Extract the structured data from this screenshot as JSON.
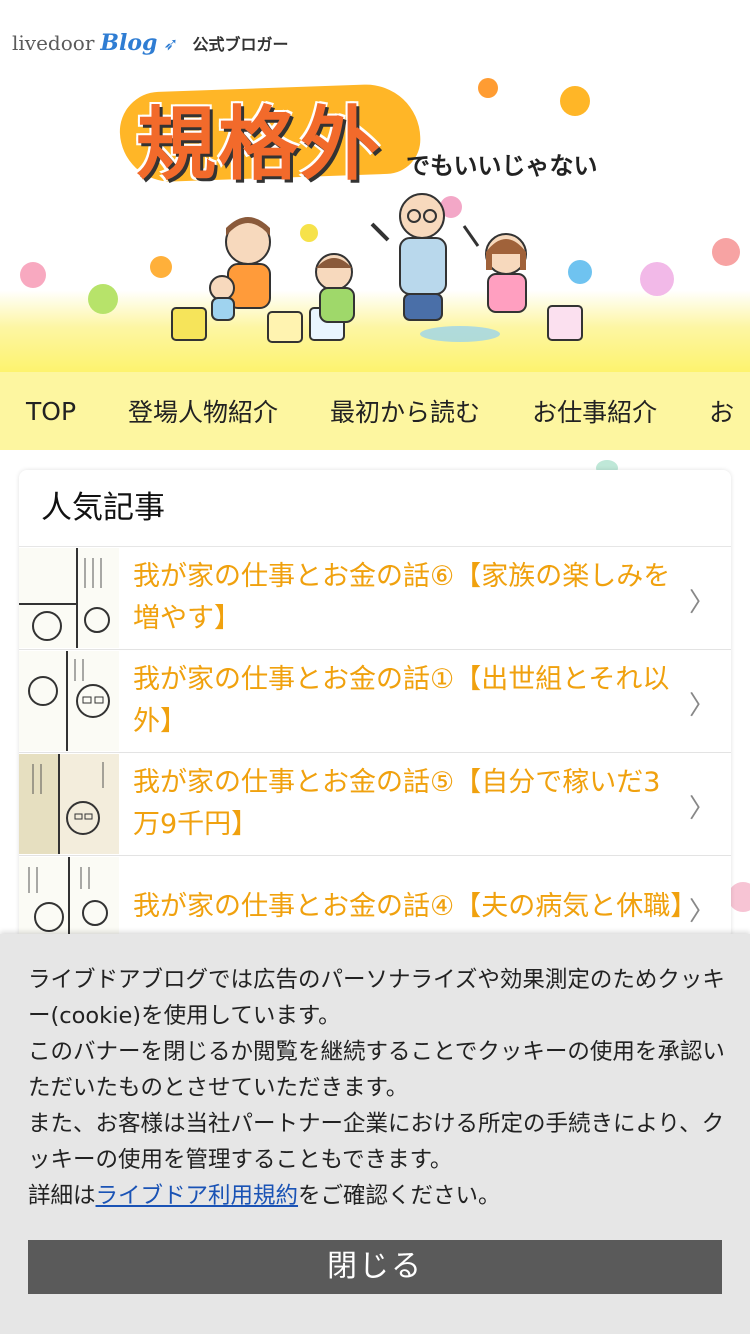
{
  "header": {
    "brand_livedoor": "livedoor",
    "brand_blog": "Blog",
    "brand_official": "公式ブロガー",
    "logo_title": "規格外",
    "logo_subtitle": "でもいいじゃない"
  },
  "nav": {
    "items": [
      {
        "label": "TOP"
      },
      {
        "label": "登場人物紹介"
      },
      {
        "label": "最初から読む"
      },
      {
        "label": "お仕事紹介"
      },
      {
        "label": "お"
      }
    ]
  },
  "popular": {
    "title": "人気記事",
    "articles": [
      {
        "title": "我が家の仕事とお金の話⑥【家族の楽しみを増やす】"
      },
      {
        "title": "我が家の仕事とお金の話①【出世組とそれ以外】"
      },
      {
        "title": "我が家の仕事とお金の話⑤【自分で稼いだ3万9千円】"
      },
      {
        "title": "我が家の仕事とお金の話④【夫の病気と休職】"
      }
    ]
  },
  "cookie": {
    "line1": "ライブドアブログでは広告のパーソナライズや効果測定のためクッキー(cookie)を使用しています。",
    "line2": "このバナーを閉じるか閲覧を継続することでクッキーの使用を承認いただいたものとさせていただきます。",
    "line3": "また、お客様は当社パートナー企業における所定の手続きにより、クッキーの使用を管理することもできます。",
    "detail_prefix": "詳細は",
    "link_label": "ライブドア利用規約",
    "detail_suffix": "をご確認ください。",
    "close_label": "閉じる"
  },
  "colors": {
    "accent_link": "#f0a10e",
    "nav_bg": "#fdf6a0",
    "close_button_bg": "#5a5a5a",
    "cookie_link": "#1a53b5"
  },
  "icons": {
    "chevron": "chevron-right-icon"
  }
}
